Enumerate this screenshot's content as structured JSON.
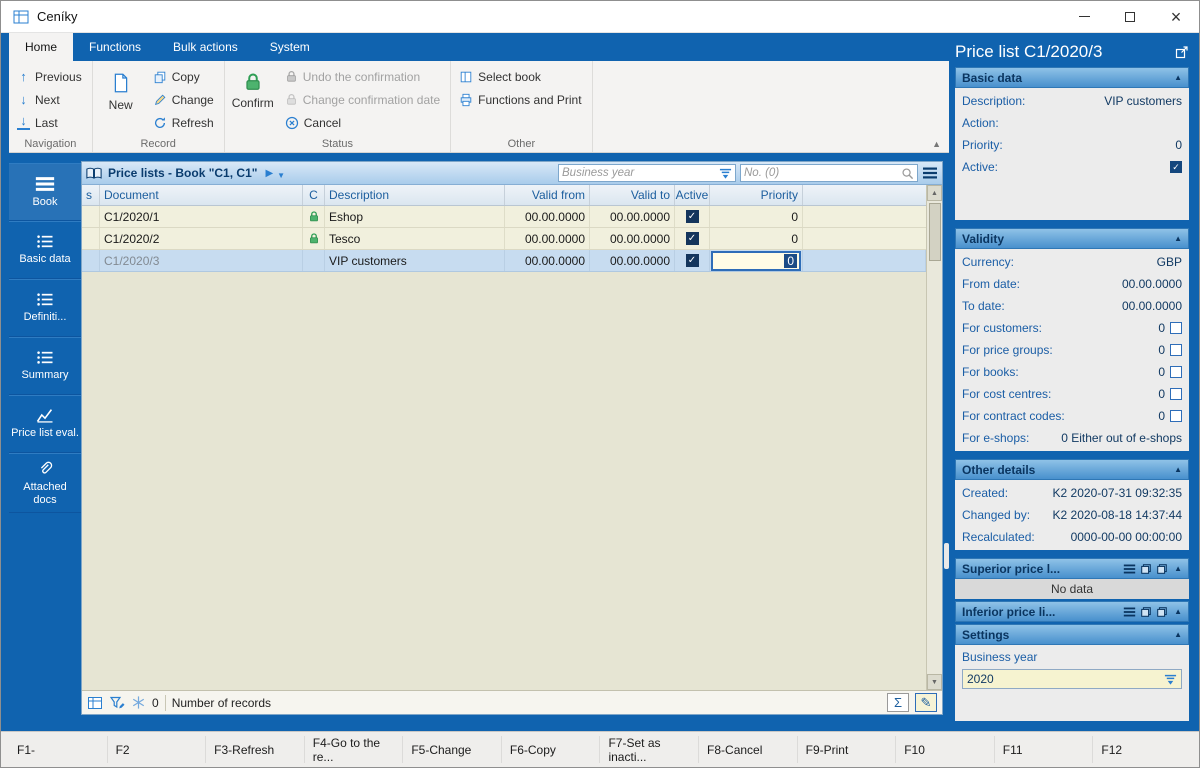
{
  "titlebar": {
    "title": "Ceníky"
  },
  "menubar": {
    "tabs": [
      "Home",
      "Functions",
      "Bulk actions",
      "System"
    ]
  },
  "ribbon": {
    "navigation": {
      "label": "Navigation",
      "previous": "Previous",
      "next": "Next",
      "last": "Last"
    },
    "record": {
      "label": "Record",
      "new": "New",
      "copy": "Copy",
      "change": "Change",
      "refresh": "Refresh"
    },
    "status": {
      "label": "Status",
      "confirm": "Confirm",
      "undo": "Undo the confirmation",
      "change_date": "Change confirmation date",
      "cancel": "Cancel"
    },
    "other": {
      "label": "Other",
      "select_book": "Select book",
      "functions_print": "Functions and Print"
    }
  },
  "sidebar": {
    "items": [
      {
        "label": "Book"
      },
      {
        "label": "Basic data"
      },
      {
        "label": "Definiti..."
      },
      {
        "label": "Summary"
      },
      {
        "label": "Price list eval."
      },
      {
        "label": "Attached docs"
      }
    ]
  },
  "browse": {
    "title": "Price lists - Book \"C1, C1\"",
    "filters": {
      "business_year_placeholder": "Business year",
      "number_placeholder": "No. (0)"
    },
    "columns": {
      "s": "s",
      "document": "Document",
      "c": "C",
      "description": "Description",
      "valid_from": "Valid from",
      "valid_to": "Valid to",
      "active": "Active",
      "priority": "Priority"
    },
    "rows": [
      {
        "document": "C1/2020/1",
        "confirmed": true,
        "description": "Eshop",
        "valid_from": "00.00.0000",
        "valid_to": "00.00.0000",
        "active": true,
        "priority": "0"
      },
      {
        "document": "C1/2020/2",
        "confirmed": true,
        "description": "Tesco",
        "valid_from": "00.00.0000",
        "valid_to": "00.00.0000",
        "active": true,
        "priority": "0"
      },
      {
        "document": "C1/2020/3",
        "confirmed": false,
        "description": "VIP customers",
        "valid_from": "00.00.0000",
        "valid_to": "00.00.0000",
        "active": true,
        "priority": "0"
      }
    ],
    "statusbar": {
      "frozen_count": "0",
      "records_label": "Number of records",
      "sum_symbol": "Σ",
      "edit_symbol": "✎"
    }
  },
  "panel": {
    "title": "Price list C1/2020/3",
    "basic": {
      "title": "Basic data",
      "description_label": "Description:",
      "description_value": "VIP customers",
      "action_label": "Action:",
      "action_value": "",
      "priority_label": "Priority:",
      "priority_value": "0",
      "active_label": "Active:",
      "active_checked": true
    },
    "validity": {
      "title": "Validity",
      "currency_label": "Currency:",
      "currency_value": "GBP",
      "from_label": "From date:",
      "from_value": "00.00.0000",
      "to_label": "To date:",
      "to_value": "00.00.0000",
      "customers_label": "For customers:",
      "customers_value": "0",
      "customers_checked": false,
      "price_groups_label": "For price groups:",
      "price_groups_value": "0",
      "price_groups_checked": false,
      "books_label": "For books:",
      "books_value": "0",
      "books_checked": false,
      "cost_centres_label": "For cost centres:",
      "cost_centres_value": "0",
      "cost_centres_checked": false,
      "contract_codes_label": "For contract codes:",
      "contract_codes_value": "0",
      "contract_codes_checked": false,
      "eshops_label": "For e-shops:",
      "eshops_value": "0 Either out of e-shops"
    },
    "other_details": {
      "title": "Other details",
      "created_label": "Created:",
      "created_value": "K2 2020-07-31 09:32:35",
      "changed_label": "Changed by:",
      "changed_value": "K2 2020-08-18 14:37:44",
      "recalculated_label": "Recalculated:",
      "recalculated_value": "0000-00-00 00:00:00"
    },
    "superior": {
      "title": "Superior price l...",
      "no_data": "No data"
    },
    "inferior": {
      "title": "Inferior price li..."
    },
    "settings": {
      "title": "Settings",
      "business_year_label": "Business year",
      "business_year_value": "2020"
    }
  },
  "function_bar": {
    "keys": [
      "F1-",
      "F2",
      "F3-Refresh",
      "F4-Go to the re...",
      "F5-Change",
      "F6-Copy",
      "F7-Set as inacti...",
      "F8-Cancel",
      "F9-Print",
      "F10",
      "F11",
      "F12"
    ]
  }
}
